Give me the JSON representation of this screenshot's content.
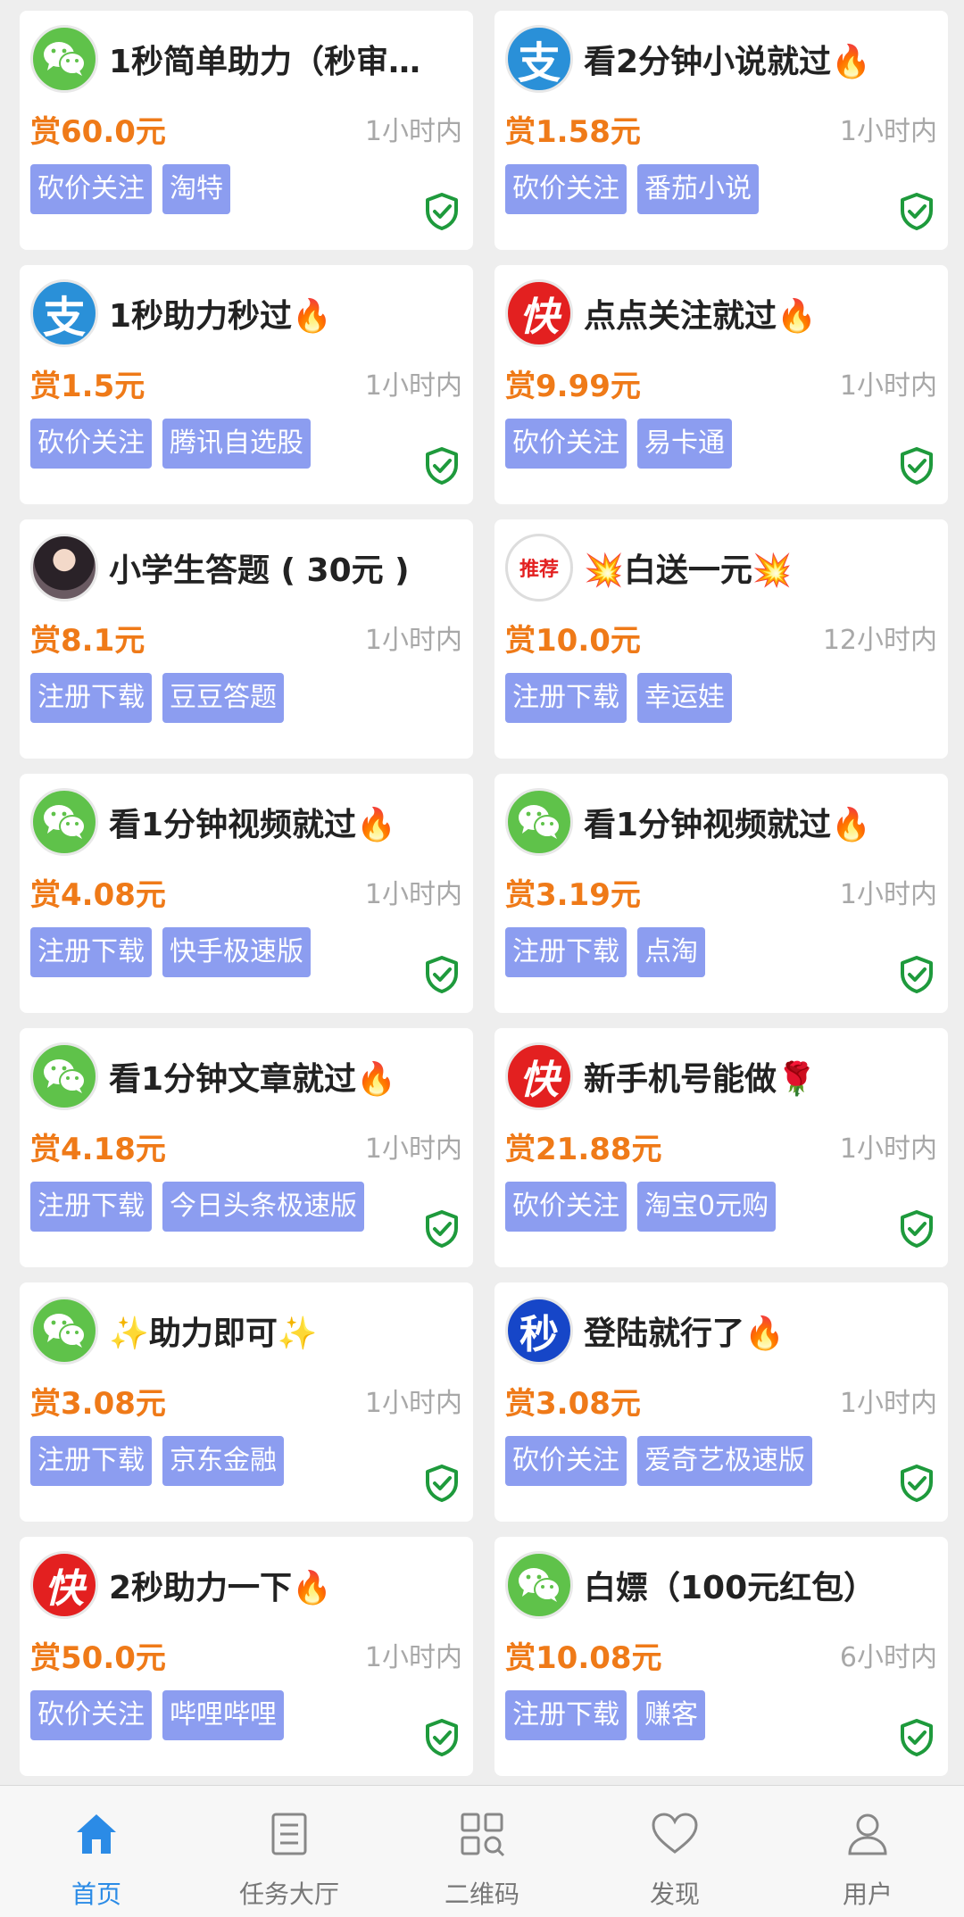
{
  "colors": {
    "reward": "#ef7a18",
    "tag": "#8c9df0",
    "shield": "#1e9a3c",
    "tab_active": "#2b8be6"
  },
  "cards": [
    {
      "icon": "wechat-icon",
      "title": "1秒简单助力（秒审…",
      "reward": "赏60.0元",
      "time": "1小时内",
      "tags": [
        "砍价关注",
        "淘特"
      ],
      "verified": true
    },
    {
      "icon": "alipay-icon",
      "title": "看2分钟小说就过🔥",
      "reward": "赏1.58元",
      "time": "1小时内",
      "tags": [
        "砍价关注",
        "番茄小说"
      ],
      "verified": true
    },
    {
      "icon": "alipay-icon",
      "title": "1秒助力秒过🔥",
      "reward": "赏1.5元",
      "time": "1小时内",
      "tags": [
        "砍价关注",
        "腾讯自选股"
      ],
      "verified": true
    },
    {
      "icon": "kuai-icon",
      "title": "点点关注就过🔥",
      "reward": "赏9.99元",
      "time": "1小时内",
      "tags": [
        "砍价关注",
        "易卡通"
      ],
      "verified": true
    },
    {
      "icon": "avatar-photo",
      "title": "小学生答题 ( 30元 )",
      "reward": "赏8.1元",
      "time": "1小时内",
      "tags": [
        "注册下载",
        "豆豆答题"
      ],
      "verified": false
    },
    {
      "icon": "tuijian-icon",
      "title": "💥白送一元💥",
      "reward": "赏10.0元",
      "time": "12小时内",
      "tags": [
        "注册下载",
        "幸运娃"
      ],
      "verified": false
    },
    {
      "icon": "wechat-icon",
      "title": "看1分钟视频就过🔥",
      "reward": "赏4.08元",
      "time": "1小时内",
      "tags": [
        "注册下载",
        "快手极速版"
      ],
      "verified": true
    },
    {
      "icon": "wechat-icon",
      "title": "看1分钟视频就过🔥",
      "reward": "赏3.19元",
      "time": "1小时内",
      "tags": [
        "注册下载",
        "点淘"
      ],
      "verified": true
    },
    {
      "icon": "wechat-icon",
      "title": "看1分钟文章就过🔥",
      "reward": "赏4.18元",
      "time": "1小时内",
      "tags": [
        "注册下载",
        "今日头条极速版"
      ],
      "verified": true
    },
    {
      "icon": "kuai-icon",
      "title": "新手机号能做🌹",
      "reward": "赏21.88元",
      "time": "1小时内",
      "tags": [
        "砍价关注",
        "淘宝0元购"
      ],
      "verified": true
    },
    {
      "icon": "wechat-icon",
      "title": "✨助力即可✨",
      "reward": "赏3.08元",
      "time": "1小时内",
      "tags": [
        "注册下载",
        "京东金融"
      ],
      "verified": true
    },
    {
      "icon": "miao-icon",
      "title": "登陆就行了🔥",
      "reward": "赏3.08元",
      "time": "1小时内",
      "tags": [
        "砍价关注",
        "爱奇艺极速版"
      ],
      "verified": true
    },
    {
      "icon": "kuai-icon",
      "title": "2秒助力一下🔥",
      "reward": "赏50.0元",
      "time": "1小时内",
      "tags": [
        "砍价关注",
        "哔哩哔哩"
      ],
      "verified": true
    },
    {
      "icon": "wechat-icon",
      "title": "白嫖（100元红包）",
      "reward": "赏10.08元",
      "time": "6小时内",
      "tags": [
        "注册下载",
        "赚客"
      ],
      "verified": true
    }
  ],
  "avatar_text": {
    "alipay": "支",
    "kuai": "快",
    "miao": "秒",
    "tuijian": "推荐"
  },
  "tabbar": [
    {
      "label": "首页",
      "icon": "home-icon",
      "active": true
    },
    {
      "label": "任务大厅",
      "icon": "task-list-icon",
      "active": false
    },
    {
      "label": "二维码",
      "icon": "qrcode-icon",
      "active": false
    },
    {
      "label": "发现",
      "icon": "heart-icon",
      "active": false
    },
    {
      "label": "用户",
      "icon": "user-icon",
      "active": false
    }
  ]
}
